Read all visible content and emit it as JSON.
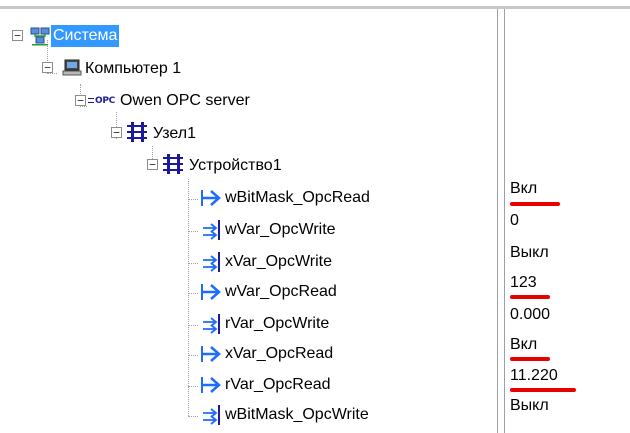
{
  "tree": {
    "root": {
      "label": "Система",
      "expander": "−",
      "icon": "network-system-icon"
    },
    "computer": {
      "label": "Компьютер 1",
      "expander": "−",
      "icon": "computer-icon"
    },
    "opc_server": {
      "label": "Owen OPC server",
      "expander": "−",
      "icon_text": "OPC",
      "icon": "opc-server-icon"
    },
    "node": {
      "label": "Узел1",
      "expander": "−",
      "icon": "node-icon"
    },
    "device": {
      "label": "Устройство1",
      "expander": "−",
      "icon": "device-icon"
    },
    "variables": [
      {
        "label": "wBitMask_OpcRead",
        "value": "Вкл",
        "icon": "read-arrow-icon",
        "underlined": true
      },
      {
        "label": "wVar_OpcWrite",
        "value": "0",
        "icon": "write-arrow-icon",
        "underlined": false
      },
      {
        "label": "xVar_OpcWrite",
        "value": "Выкл",
        "icon": "write-arrow-icon",
        "underlined": false
      },
      {
        "label": "wVar_OpcRead",
        "value": "123",
        "icon": "read-arrow-icon",
        "underlined": true
      },
      {
        "label": "rVar_OpcWrite",
        "value": "0.000",
        "icon": "write-arrow-icon",
        "underlined": false
      },
      {
        "label": "xVar_OpcRead",
        "value": "Вкл",
        "icon": "read-arrow-icon",
        "underlined": true
      },
      {
        "label": "rVar_OpcRead",
        "value": "11.220",
        "icon": "read-arrow-icon",
        "underlined": true
      },
      {
        "label": "wBitMask_OpcWrite",
        "value": "Выкл",
        "icon": "write-arrow-icon",
        "underlined": false
      }
    ]
  },
  "colors": {
    "selection": "#3399ff",
    "annotation": "#e60000",
    "read_icon": "#1e6cff",
    "write_icon": "#1a1a9a"
  }
}
